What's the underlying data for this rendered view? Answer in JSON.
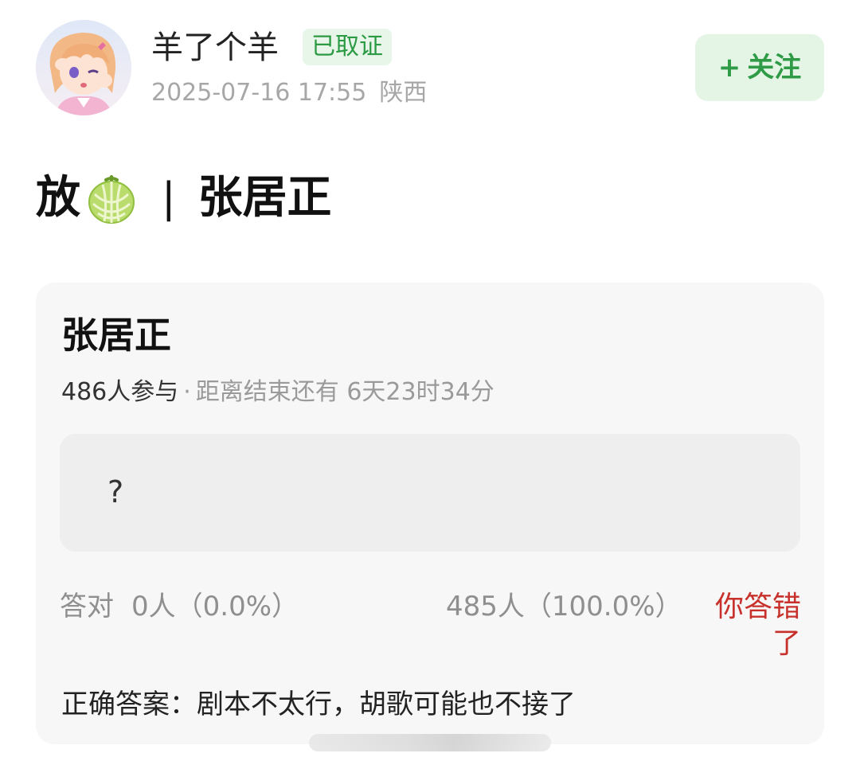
{
  "post": {
    "author": {
      "name": "羊了个羊",
      "badge": "已取证",
      "avatar_icon": "anime-avatar-icon"
    },
    "time": "2025-07-16 17:55",
    "location": "陕西",
    "follow_button": {
      "plus": "+",
      "label": "关注"
    },
    "title": {
      "part1": "放",
      "emoji_icon": "melon-icon",
      "separator": "|",
      "part2": "张居正"
    }
  },
  "quiz": {
    "title": "张居正",
    "participants": "486人参与",
    "dot": "·",
    "countdown": "距离结束还有 6天23时34分",
    "question": "?",
    "correct_label": "答对",
    "correct_count": "0人（0.0%）",
    "wrong_count": "485人（100.0%）",
    "wrong_tag": "你答错了",
    "answer": "正确答案：剧本不太行，胡歌可能也不接了"
  },
  "colors": {
    "accent_green": "#2f9b46",
    "badge_bg": "#e7f6e8",
    "error_red": "#c8312b",
    "card_bg": "#f7f7f7"
  }
}
